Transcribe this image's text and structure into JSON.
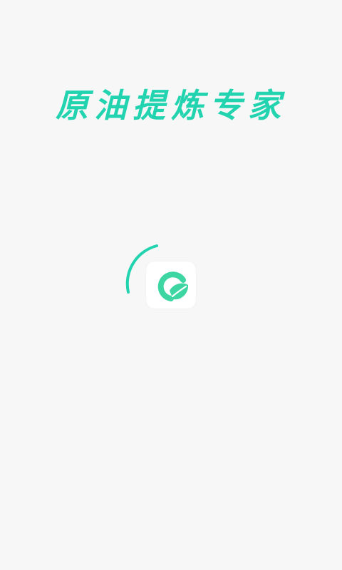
{
  "splash": {
    "title": "原油提炼专家",
    "accent_color": "#22d3b0",
    "logo_color": "#3dd6a3",
    "background_color": "#f7f7f7"
  },
  "icons": {
    "loading": "loading-spinner-icon",
    "app_logo": "app-logo-leaf-icon"
  }
}
